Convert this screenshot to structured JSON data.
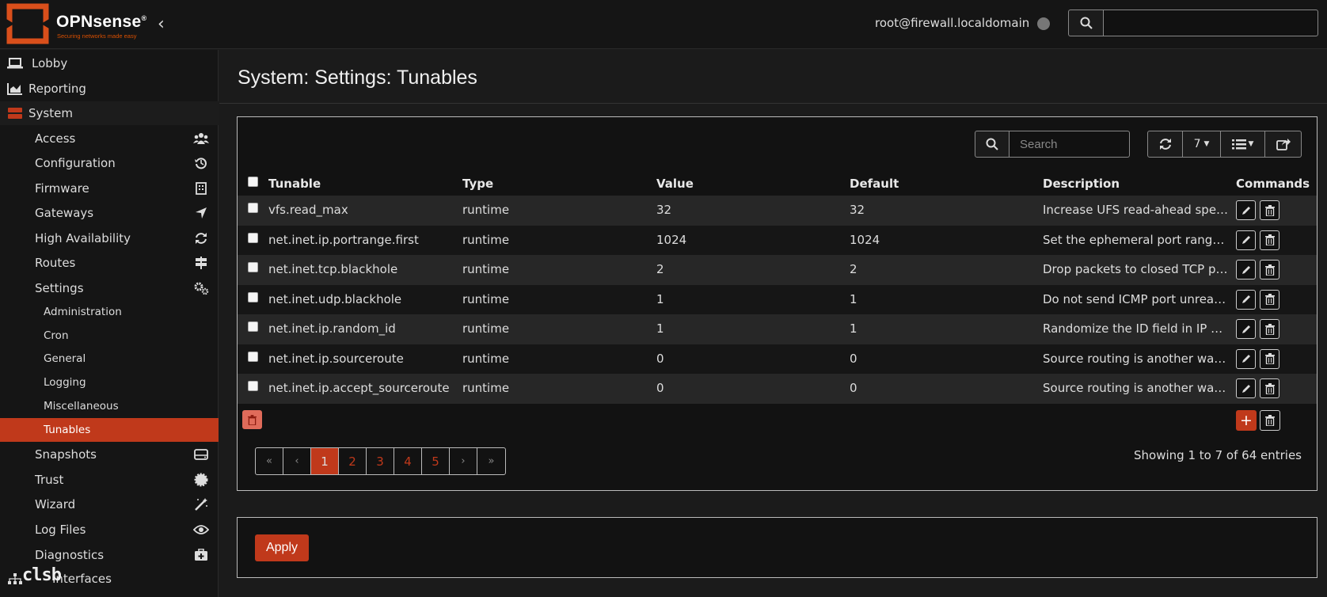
{
  "header": {
    "brand": "OPNsense",
    "brand_mark": "®",
    "tagline": "Securing networks made easy",
    "user": "root@firewall.localdomain",
    "search_placeholder": ""
  },
  "sidebar": {
    "items": [
      {
        "label": "Lobby",
        "icon": "laptop-icon"
      },
      {
        "label": "Reporting",
        "icon": "chart-area-icon"
      },
      {
        "label": "System",
        "icon": "server-icon"
      }
    ],
    "system_children": [
      {
        "label": "Access",
        "icon": "users-icon"
      },
      {
        "label": "Configuration",
        "icon": "history-icon"
      },
      {
        "label": "Firmware",
        "icon": "building-icon"
      },
      {
        "label": "Gateways",
        "icon": "location-arrow-icon"
      },
      {
        "label": "High Availability",
        "icon": "refresh-icon"
      },
      {
        "label": "Routes",
        "icon": "signs-icon"
      },
      {
        "label": "Settings",
        "icon": "cogs-icon"
      }
    ],
    "settings_children": [
      {
        "label": "Administration"
      },
      {
        "label": "Cron"
      },
      {
        "label": "General"
      },
      {
        "label": "Logging"
      },
      {
        "label": "Miscellaneous"
      },
      {
        "label": "Tunables",
        "active": true
      }
    ],
    "after_items": [
      {
        "label": "Snapshots",
        "icon": "hdd-icon"
      },
      {
        "label": "Trust",
        "icon": "certificate-icon"
      },
      {
        "label": "Wizard",
        "icon": "magic-icon"
      },
      {
        "label": "Log Files",
        "icon": "eye-icon"
      },
      {
        "label": "Diagnostics",
        "icon": "medkit-icon"
      }
    ],
    "bottom_partial": "Interfaces"
  },
  "page": {
    "title": "System: Settings: Tunables"
  },
  "grid": {
    "search_placeholder": "Search",
    "page_size": "7",
    "columns": [
      "Tunable",
      "Type",
      "Value",
      "Default",
      "Description",
      "Commands"
    ],
    "rows": [
      {
        "tunable": "vfs.read_max",
        "type": "runtime",
        "value": "32",
        "default": "32",
        "description": "Increase UFS read-ahead speed…"
      },
      {
        "tunable": "net.inet.ip.portrange.first",
        "type": "runtime",
        "value": "1024",
        "default": "1024",
        "description": "Set the ephemeral port range to…"
      },
      {
        "tunable": "net.inet.tcp.blackhole",
        "type": "runtime",
        "value": "2",
        "default": "2",
        "description": "Drop packets to closed TCP port…"
      },
      {
        "tunable": "net.inet.udp.blackhole",
        "type": "runtime",
        "value": "1",
        "default": "1",
        "description": "Do not send ICMP port unreach…"
      },
      {
        "tunable": "net.inet.ip.random_id",
        "type": "runtime",
        "value": "1",
        "default": "1",
        "description": "Randomize the ID field in IP pac…"
      },
      {
        "tunable": "net.inet.ip.sourceroute",
        "type": "runtime",
        "value": "0",
        "default": "0",
        "description": "Source routing is another way f…"
      },
      {
        "tunable": "net.inet.ip.accept_sourceroute",
        "type": "runtime",
        "value": "0",
        "default": "0",
        "description": "Source routing is another way f…"
      }
    ],
    "pagination": [
      "«",
      "‹",
      "1",
      "2",
      "3",
      "4",
      "5",
      "›",
      "»"
    ],
    "current_page": "1",
    "showing": "Showing 1 to 7 of 64 entries",
    "add_label": "+"
  },
  "apply_label": "Apply",
  "watermark": "clsb",
  "colors": {
    "accent": "#c0391b",
    "background": "#1b1b1b",
    "sidebar": "#151515"
  }
}
